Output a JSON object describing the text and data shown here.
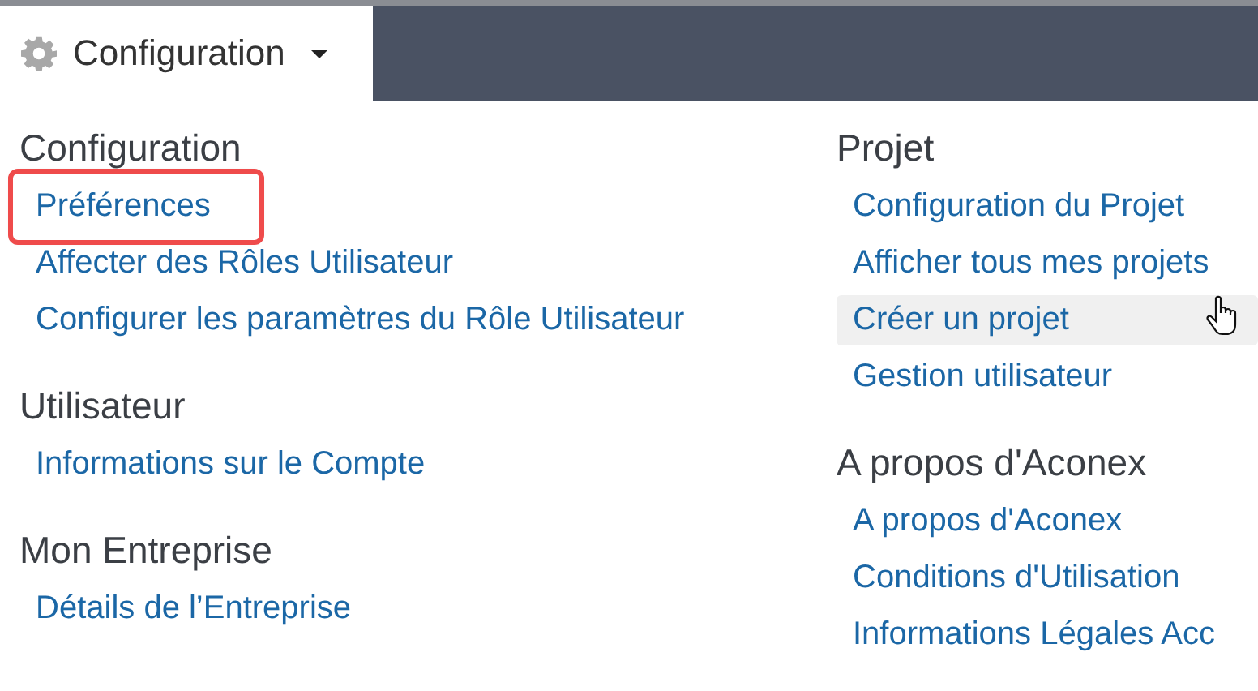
{
  "menu_tab": {
    "label": "Configuration",
    "expanded": true
  },
  "columns": [
    {
      "sections": [
        {
          "heading": "Configuration",
          "links": [
            {
              "label": "Préférences",
              "highlighted": true,
              "hovered": false
            },
            {
              "label": "Affecter des Rôles Utilisateur",
              "highlighted": false,
              "hovered": false
            },
            {
              "label": "Configurer les paramètres du Rôle Utilisateur",
              "highlighted": false,
              "hovered": false
            }
          ]
        },
        {
          "heading": "Utilisateur",
          "links": [
            {
              "label": "Informations sur le Compte",
              "highlighted": false,
              "hovered": false
            }
          ]
        },
        {
          "heading": "Mon Entreprise",
          "links": [
            {
              "label": "Détails de l’Entreprise",
              "highlighted": false,
              "hovered": false
            }
          ]
        }
      ]
    },
    {
      "sections": [
        {
          "heading": "Projet",
          "links": [
            {
              "label": "Configuration du Projet",
              "highlighted": false,
              "hovered": false
            },
            {
              "label": "Afficher tous mes projets",
              "highlighted": false,
              "hovered": false
            },
            {
              "label": "Créer un projet",
              "highlighted": false,
              "hovered": true
            },
            {
              "label": "Gestion utilisateur",
              "highlighted": false,
              "hovered": false
            }
          ]
        },
        {
          "heading": "A propos d'Aconex",
          "links": [
            {
              "label": "A propos d'Aconex",
              "highlighted": false,
              "hovered": false
            },
            {
              "label": "Conditions d'Utilisation",
              "highlighted": false,
              "hovered": false
            },
            {
              "label": "Informations Légales Acc",
              "highlighted": false,
              "hovered": false
            }
          ]
        }
      ]
    }
  ]
}
